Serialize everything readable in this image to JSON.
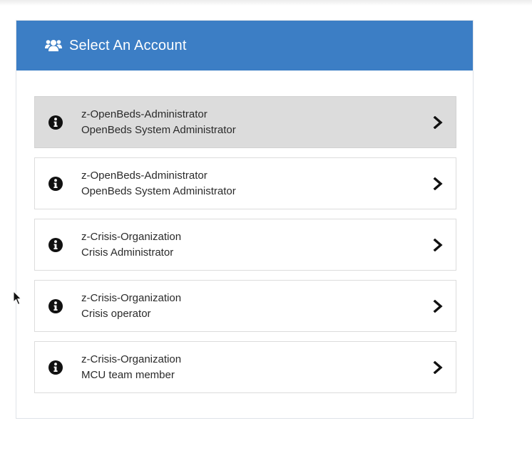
{
  "header": {
    "icon": "users-icon",
    "title": "Select An Account"
  },
  "accounts": [
    {
      "organization": "z-OpenBeds-Administrator",
      "role": "OpenBeds System Administrator",
      "selected": true
    },
    {
      "organization": "z-OpenBeds-Administrator",
      "role": "OpenBeds System Administrator",
      "selected": false
    },
    {
      "organization": "z-Crisis-Organization",
      "role": "Crisis Administrator",
      "selected": false
    },
    {
      "organization": "z-Crisis-Organization",
      "role": "Crisis operator",
      "selected": false
    },
    {
      "organization": "z-Crisis-Organization",
      "role": "MCU team member",
      "selected": false
    }
  ],
  "icons": {
    "info": "info-circle-icon",
    "chevron": "chevron-right-icon",
    "cursor": "mouse-pointer-icon"
  },
  "colors": {
    "header_bg": "#3c7ec5",
    "selected_bg": "#dcdcdc",
    "border": "#dcdcdc",
    "text": "#2a2a2a"
  }
}
